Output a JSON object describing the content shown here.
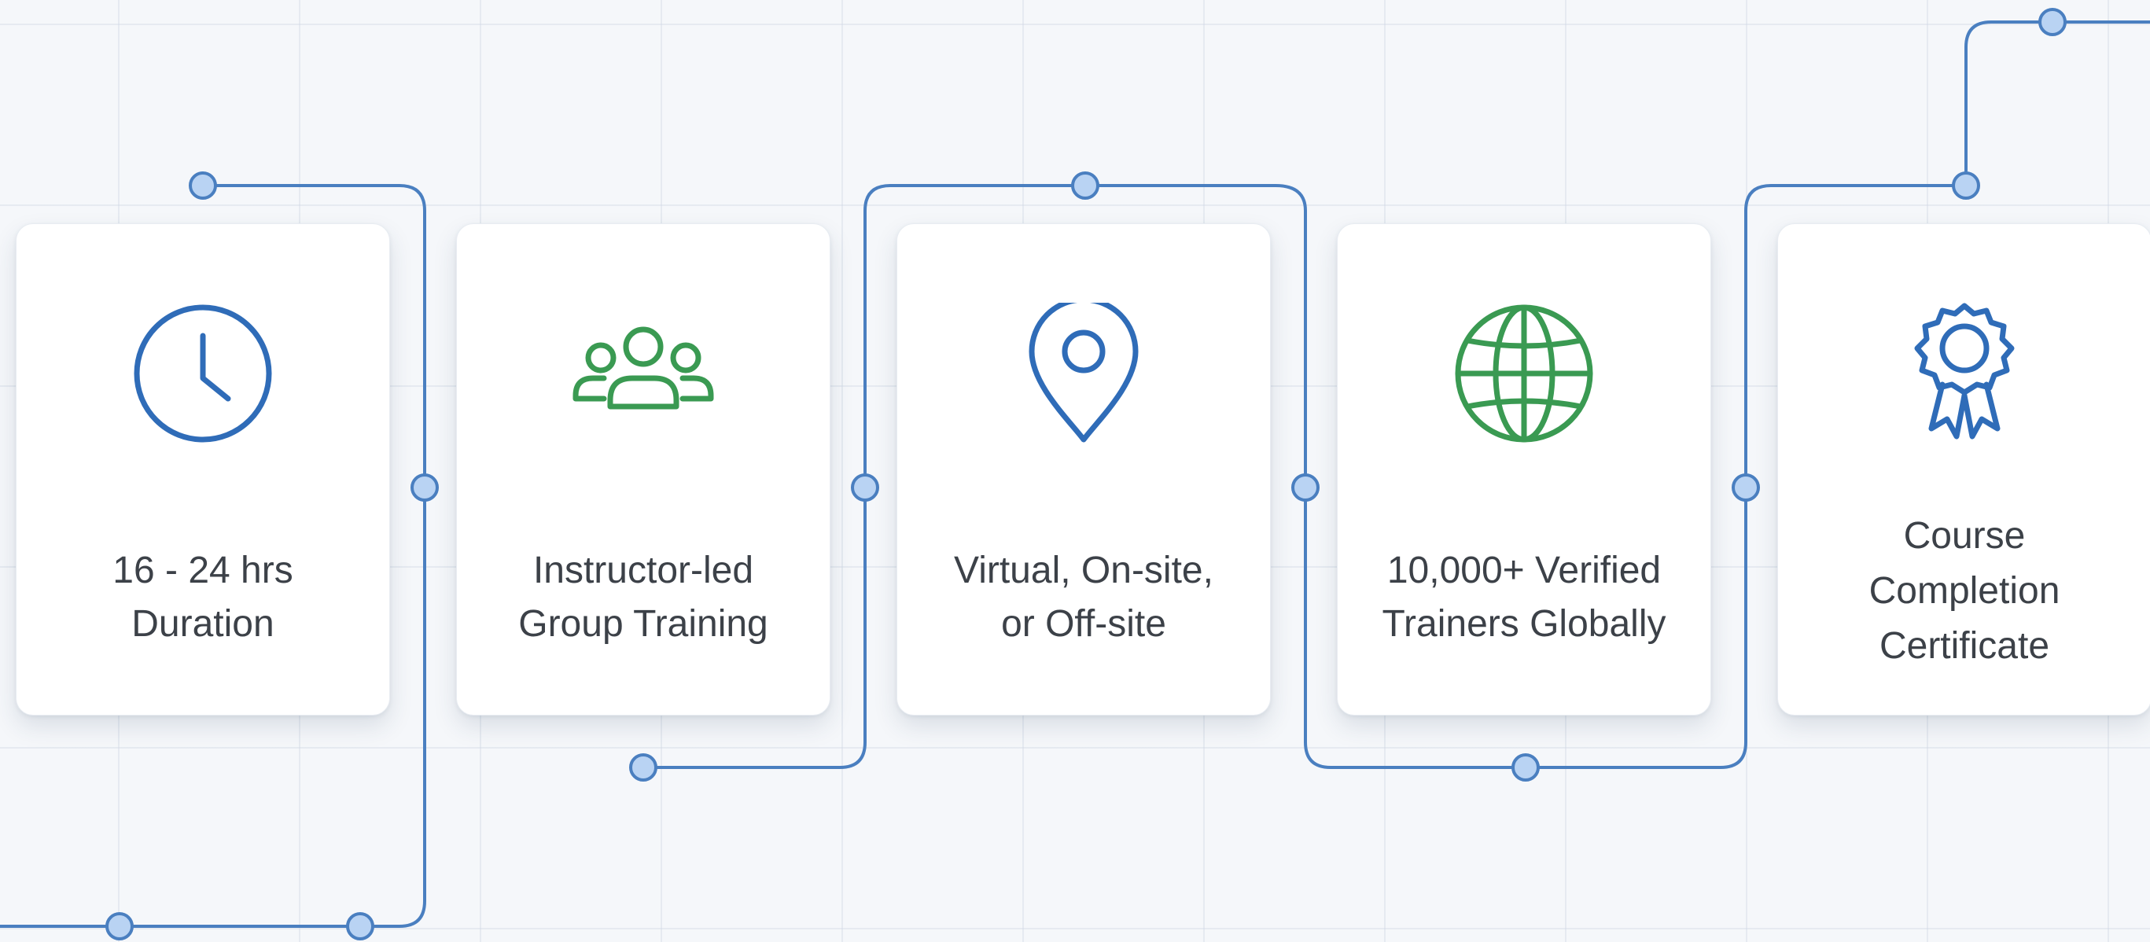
{
  "cards": [
    {
      "label": "16 - 24 hrs\nDuration",
      "icon": "clock-icon",
      "icon_color": "#2f6cb8"
    },
    {
      "label": "Instructor-led\nGroup Training",
      "icon": "group-icon",
      "icon_color": "#3a9a52"
    },
    {
      "label": "Virtual, On-site,\nor Off-site",
      "icon": "location-pin-icon",
      "icon_color": "#2f6cb8"
    },
    {
      "label": "10,000+ Verified\nTrainers Globally",
      "icon": "globe-icon",
      "icon_color": "#3a9a52"
    },
    {
      "label": "Course\nCompletion\nCertificate",
      "icon": "award-ribbon-icon",
      "icon_color": "#2f6cb8"
    }
  ],
  "colors": {
    "background": "#f5f7fa",
    "connector_line": "#4a7fc0",
    "node_fill": "#b9d3f3",
    "node_stroke": "#4a7fc0",
    "text": "#3c4148"
  }
}
